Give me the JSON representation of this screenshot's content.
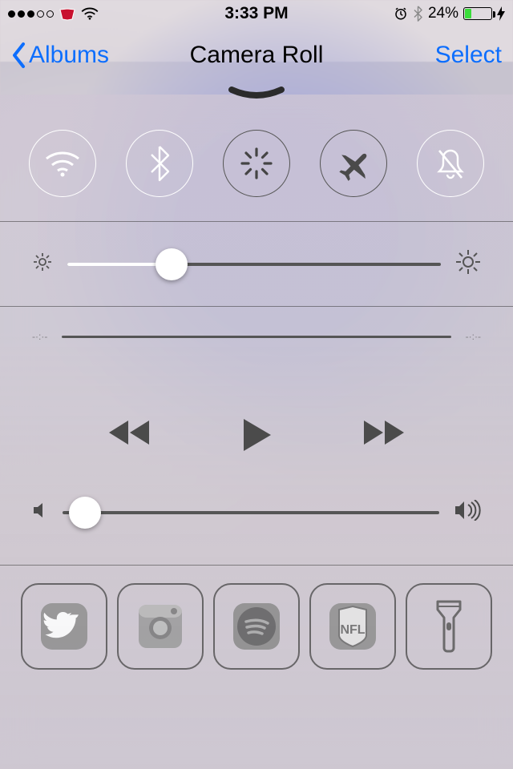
{
  "status": {
    "signal_filled": 3,
    "signal_total": 5,
    "carrier_icon": "chiefs-logo",
    "wifi": true,
    "time": "3:33 PM",
    "alarm": true,
    "bluetooth": true,
    "battery_pct": "24%",
    "battery_level": 0.24,
    "charging": true
  },
  "nav": {
    "back_label": "Albums",
    "title": "Camera Roll",
    "right_label": "Select"
  },
  "control_center": {
    "toggles": {
      "wifi": {
        "name": "wifi",
        "on": true
      },
      "bluetooth": {
        "name": "bluetooth",
        "on": true
      },
      "dnd_spinner": {
        "name": "loading",
        "on": false
      },
      "airplane": {
        "name": "airplane",
        "on": false
      },
      "mute": {
        "name": "mute",
        "on": true
      }
    },
    "brightness": 0.28,
    "scrubber": 0.0,
    "volume": 0.06,
    "quick_launch": [
      {
        "name": "twitter",
        "label": "Twitter"
      },
      {
        "name": "instagram",
        "label": "Instagram"
      },
      {
        "name": "spotify",
        "label": "Spotify"
      },
      {
        "name": "nfl",
        "label": "NFL"
      },
      {
        "name": "flashlight",
        "label": "Flashlight"
      }
    ]
  }
}
